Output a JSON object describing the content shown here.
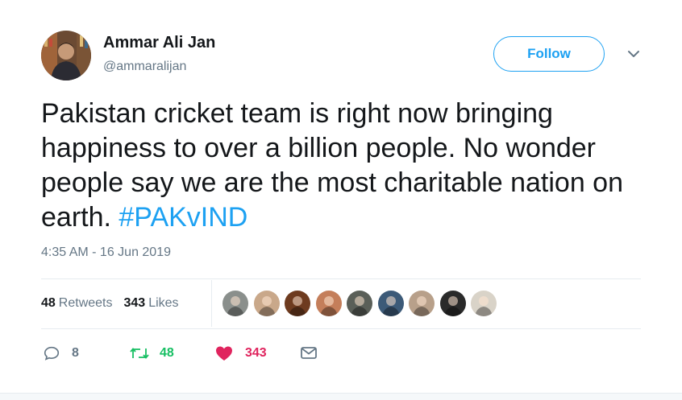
{
  "user": {
    "name": "Ammar Ali Jan",
    "handle": "@ammaralijan",
    "avatar_icon": "profile-photo"
  },
  "header": {
    "follow_label": "Follow",
    "menu_icon": "chevron-down-icon"
  },
  "tweet": {
    "text": "Pakistan cricket team is right now bringing happiness to over a billion people. No wonder people say we are the most charitable nation on earth. ",
    "hashtag": "#PAKvIND",
    "timestamp": "4:35 AM - 16 Jun 2019"
  },
  "stats": {
    "retweets_count": "48",
    "retweets_label": "Retweets",
    "likes_count": "343",
    "likes_label": "Likes"
  },
  "likers": [
    {
      "icon": "liker-avatar-1",
      "color": "#8a8f8c"
    },
    {
      "icon": "liker-avatar-2",
      "color": "#c9a88a"
    },
    {
      "icon": "liker-avatar-3",
      "color": "#6e3b1f"
    },
    {
      "icon": "liker-avatar-4",
      "color": "#c47e5a"
    },
    {
      "icon": "liker-avatar-5",
      "color": "#5a5f58"
    },
    {
      "icon": "liker-avatar-6",
      "color": "#3c5a78"
    },
    {
      "icon": "liker-avatar-7",
      "color": "#b8a08a"
    },
    {
      "icon": "liker-avatar-8",
      "color": "#2a2a2a"
    },
    {
      "icon": "liker-avatar-9",
      "color": "#d9d3c8"
    }
  ],
  "actions": {
    "reply_count": "8",
    "retweet_count": "48",
    "like_count": "343"
  },
  "colors": {
    "accent": "#1da1f2",
    "retweet": "#17bf63",
    "like": "#e0245e",
    "muted": "#657786"
  }
}
